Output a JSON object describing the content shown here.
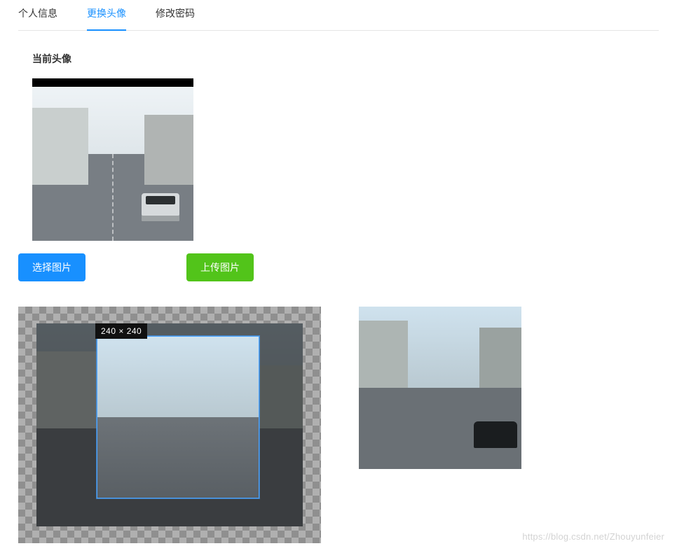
{
  "tabs": [
    {
      "label": "个人信息",
      "active": false
    },
    {
      "label": "更换头像",
      "active": true
    },
    {
      "label": "修改密码",
      "active": false
    }
  ],
  "section": {
    "current_avatar_title": "当前头像"
  },
  "buttons": {
    "select_image": "选择图片",
    "upload_image": "上传图片"
  },
  "cropper": {
    "crop_size_label": "240 × 240"
  },
  "watermark": "https://blog.csdn.net/Zhouyunfeier"
}
